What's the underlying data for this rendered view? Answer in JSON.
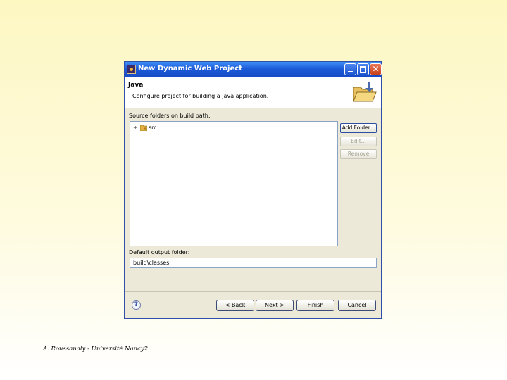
{
  "window": {
    "title": "New Dynamic Web Project",
    "buttons": [
      "minimize",
      "maximize",
      "close"
    ],
    "close_glyph": "✕"
  },
  "header": {
    "title": "Java",
    "description": "Configure project for building a Java application.",
    "icon": "folder-icon"
  },
  "source_folders": {
    "label": "Source folders on build path:",
    "items": [
      {
        "label": "src",
        "expander": "+",
        "icon": "package-folder-icon"
      }
    ],
    "buttons": {
      "add": "Add Folder...",
      "edit": "Edit...",
      "remove": "Remove"
    }
  },
  "output_folder": {
    "label": "Default output folder:",
    "value": "build\\classes"
  },
  "footer": {
    "help": "?",
    "back": "< Back",
    "next": "Next >",
    "finish": "Finish",
    "cancel": "Cancel"
  },
  "credit": "A. Roussanaly - Université Nancy2",
  "colors": {
    "titlebar": "#1c5ad8",
    "dialog_bg": "#ece9d8",
    "page_bg": "#fdf7c2"
  }
}
